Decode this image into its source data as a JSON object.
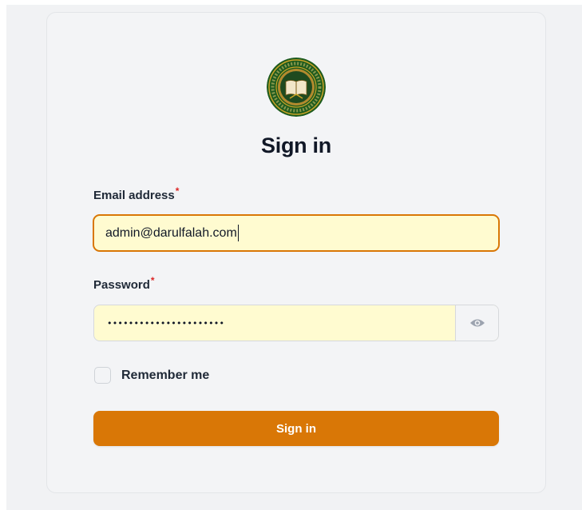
{
  "logo": {
    "icon": "institution-seal-icon",
    "colors": {
      "outer": "#1e5b1e",
      "ring": "#c8a227",
      "book": "#f2e6c8"
    }
  },
  "heading": {
    "title": "Sign in"
  },
  "form": {
    "email": {
      "label": "Email address",
      "required_mark": "*",
      "value": "admin@darulfalah.com"
    },
    "password": {
      "label": "Password",
      "required_mark": "*",
      "masked_value": "••••••••••••••••••••••",
      "reveal_icon": "eye-icon"
    },
    "remember": {
      "label": "Remember me",
      "checked": false
    },
    "submit": {
      "label": "Sign in"
    }
  },
  "colors": {
    "accent": "#d97706",
    "autofill": "#fffbd0",
    "required": "#dc2626"
  }
}
